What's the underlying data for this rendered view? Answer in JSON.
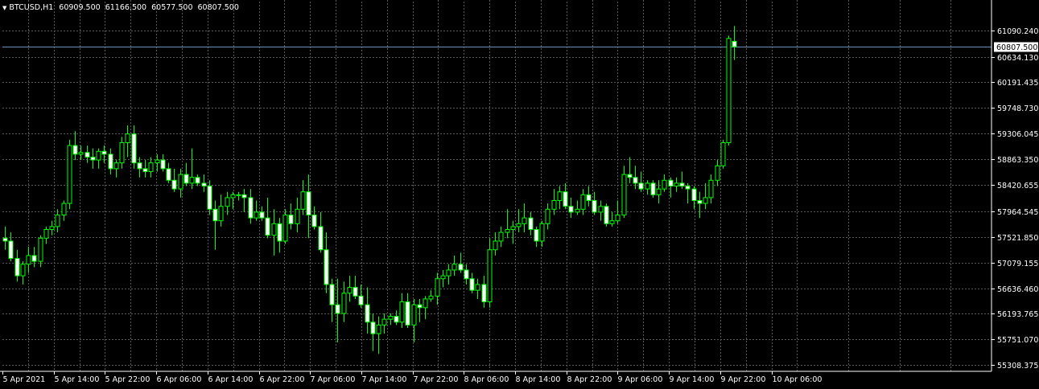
{
  "header": {
    "symbol": "BTCUSD,H1",
    "open": "60909.500",
    "high": "61166.500",
    "low": "60577.500",
    "close": "60807.500",
    "menu_icon": "triangle-down-icon"
  },
  "colors": {
    "background": "#000000",
    "grid": "#5a5a5a",
    "bull_body": "#000000",
    "bear_body": "#ffffff",
    "wick": "#00ff00",
    "axis_text": "#ffffff",
    "price_line": "#6f8faf"
  },
  "chart_data": {
    "type": "candlestick",
    "symbol": "BTCUSD",
    "timeframe": "H1",
    "price_axis_labels": [
      "61090.240",
      "60634.130",
      "60191.435",
      "59748.730",
      "59306.045",
      "58863.350",
      "58420.655",
      "57964.545",
      "57521.850",
      "57079.155",
      "56636.460",
      "56193.765",
      "55751.070",
      "55308.375"
    ],
    "time_axis_labels": [
      "5 Apr 2021",
      "5 Apr 14:00",
      "5 Apr 22:00",
      "6 Apr 06:00",
      "6 Apr 14:00",
      "6 Apr 22:00",
      "7 Apr 06:00",
      "7 Apr 14:00",
      "7 Apr 22:00",
      "8 Apr 06:00",
      "8 Apr 14:00",
      "8 Apr 22:00",
      "9 Apr 06:00",
      "9 Apr 14:00",
      "9 Apr 22:00",
      "10 Apr 06:00"
    ],
    "current_price": "60807.500",
    "grid": true,
    "ylim": [
      55200,
      61350
    ],
    "candles": [
      {
        "o": 57500,
        "h": 57700,
        "l": 57300,
        "c": 57450
      },
      {
        "o": 57450,
        "h": 57600,
        "l": 57100,
        "c": 57150
      },
      {
        "o": 57150,
        "h": 57300,
        "l": 56750,
        "c": 56850
      },
      {
        "o": 56850,
        "h": 57100,
        "l": 56700,
        "c": 57050
      },
      {
        "o": 57050,
        "h": 57350,
        "l": 56900,
        "c": 57200
      },
      {
        "o": 57200,
        "h": 57350,
        "l": 57000,
        "c": 57100
      },
      {
        "o": 57100,
        "h": 57550,
        "l": 57000,
        "c": 57500
      },
      {
        "o": 57500,
        "h": 57700,
        "l": 57400,
        "c": 57650
      },
      {
        "o": 57650,
        "h": 57800,
        "l": 57550,
        "c": 57700
      },
      {
        "o": 57700,
        "h": 58000,
        "l": 57600,
        "c": 57900
      },
      {
        "o": 57900,
        "h": 58150,
        "l": 57800,
        "c": 58100
      },
      {
        "o": 58100,
        "h": 59200,
        "l": 58000,
        "c": 59100
      },
      {
        "o": 59100,
        "h": 59350,
        "l": 58850,
        "c": 58950
      },
      {
        "o": 58950,
        "h": 59100,
        "l": 58850,
        "c": 58980
      },
      {
        "o": 58980,
        "h": 59100,
        "l": 58800,
        "c": 58900
      },
      {
        "o": 58900,
        "h": 59050,
        "l": 58700,
        "c": 58850
      },
      {
        "o": 58850,
        "h": 59050,
        "l": 58700,
        "c": 59000
      },
      {
        "o": 59000,
        "h": 59100,
        "l": 58800,
        "c": 58950
      },
      {
        "o": 58950,
        "h": 59050,
        "l": 58600,
        "c": 58700
      },
      {
        "o": 58700,
        "h": 58850,
        "l": 58550,
        "c": 58800
      },
      {
        "o": 58800,
        "h": 59250,
        "l": 58700,
        "c": 59150
      },
      {
        "o": 59150,
        "h": 59450,
        "l": 58900,
        "c": 59300
      },
      {
        "o": 59300,
        "h": 59450,
        "l": 58700,
        "c": 58800
      },
      {
        "o": 58800,
        "h": 58900,
        "l": 58550,
        "c": 58700
      },
      {
        "o": 58700,
        "h": 58850,
        "l": 58550,
        "c": 58650
      },
      {
        "o": 58650,
        "h": 58900,
        "l": 58550,
        "c": 58800
      },
      {
        "o": 58800,
        "h": 58950,
        "l": 58650,
        "c": 58850
      },
      {
        "o": 58850,
        "h": 58950,
        "l": 58650,
        "c": 58700
      },
      {
        "o": 58700,
        "h": 58800,
        "l": 58450,
        "c": 58500
      },
      {
        "o": 58500,
        "h": 58700,
        "l": 58300,
        "c": 58350
      },
      {
        "o": 58350,
        "h": 58700,
        "l": 58200,
        "c": 58600
      },
      {
        "o": 58600,
        "h": 58800,
        "l": 58400,
        "c": 58450
      },
      {
        "o": 58450,
        "h": 59050,
        "l": 58350,
        "c": 58550
      },
      {
        "o": 58550,
        "h": 58600,
        "l": 58400,
        "c": 58450
      },
      {
        "o": 58450,
        "h": 58600,
        "l": 58300,
        "c": 58400
      },
      {
        "o": 58400,
        "h": 58500,
        "l": 57900,
        "c": 58000
      },
      {
        "o": 58000,
        "h": 58150,
        "l": 57300,
        "c": 57800
      },
      {
        "o": 57800,
        "h": 58250,
        "l": 57700,
        "c": 58050
      },
      {
        "o": 58050,
        "h": 58300,
        "l": 57900,
        "c": 58200
      },
      {
        "o": 58200,
        "h": 58300,
        "l": 58000,
        "c": 58250
      },
      {
        "o": 58250,
        "h": 58300,
        "l": 58150,
        "c": 58250
      },
      {
        "o": 58250,
        "h": 58350,
        "l": 57950,
        "c": 58200
      },
      {
        "o": 58200,
        "h": 58350,
        "l": 57750,
        "c": 57850
      },
      {
        "o": 57850,
        "h": 58150,
        "l": 57800,
        "c": 57950
      },
      {
        "o": 57950,
        "h": 58050,
        "l": 57800,
        "c": 57850
      },
      {
        "o": 57850,
        "h": 58200,
        "l": 57500,
        "c": 57550
      },
      {
        "o": 57550,
        "h": 58000,
        "l": 57200,
        "c": 57750
      },
      {
        "o": 57750,
        "h": 57850,
        "l": 57250,
        "c": 57450
      },
      {
        "o": 57450,
        "h": 58000,
        "l": 57400,
        "c": 57900
      },
      {
        "o": 57900,
        "h": 58100,
        "l": 57650,
        "c": 57750
      },
      {
        "o": 57750,
        "h": 58200,
        "l": 57600,
        "c": 58000
      },
      {
        "o": 58000,
        "h": 58500,
        "l": 57900,
        "c": 58300
      },
      {
        "o": 58300,
        "h": 58600,
        "l": 57500,
        "c": 57900
      },
      {
        "o": 57900,
        "h": 58050,
        "l": 57650,
        "c": 57700
      },
      {
        "o": 57700,
        "h": 57950,
        "l": 57250,
        "c": 57300
      },
      {
        "o": 57300,
        "h": 57600,
        "l": 56550,
        "c": 56700
      },
      {
        "o": 56700,
        "h": 56800,
        "l": 56050,
        "c": 56350
      },
      {
        "o": 56350,
        "h": 56800,
        "l": 55700,
        "c": 56200
      },
      {
        "o": 56200,
        "h": 56750,
        "l": 56050,
        "c": 56550
      },
      {
        "o": 56550,
        "h": 56850,
        "l": 56400,
        "c": 56650
      },
      {
        "o": 56650,
        "h": 56850,
        "l": 56450,
        "c": 56500
      },
      {
        "o": 56500,
        "h": 56700,
        "l": 56300,
        "c": 56350
      },
      {
        "o": 56350,
        "h": 56650,
        "l": 55850,
        "c": 56050
      },
      {
        "o": 56050,
        "h": 56200,
        "l": 55550,
        "c": 55850
      },
      {
        "o": 55850,
        "h": 56150,
        "l": 55500,
        "c": 56000
      },
      {
        "o": 56000,
        "h": 56200,
        "l": 55850,
        "c": 56100
      },
      {
        "o": 56100,
        "h": 56200,
        "l": 56000,
        "c": 56150
      },
      {
        "o": 56150,
        "h": 56250,
        "l": 56000,
        "c": 56050
      },
      {
        "o": 56050,
        "h": 56550,
        "l": 55950,
        "c": 56400
      },
      {
        "o": 56400,
        "h": 56550,
        "l": 55950,
        "c": 56000
      },
      {
        "o": 56000,
        "h": 56450,
        "l": 55700,
        "c": 56350
      },
      {
        "o": 56350,
        "h": 56450,
        "l": 56050,
        "c": 56300
      },
      {
        "o": 56300,
        "h": 56500,
        "l": 56100,
        "c": 56450
      },
      {
        "o": 56450,
        "h": 56600,
        "l": 56400,
        "c": 56500
      },
      {
        "o": 56500,
        "h": 56900,
        "l": 56350,
        "c": 56800
      },
      {
        "o": 56800,
        "h": 56950,
        "l": 56650,
        "c": 56850
      },
      {
        "o": 56850,
        "h": 57050,
        "l": 56700,
        "c": 56950
      },
      {
        "o": 56950,
        "h": 57200,
        "l": 56850,
        "c": 57050
      },
      {
        "o": 57050,
        "h": 57250,
        "l": 56900,
        "c": 56950
      },
      {
        "o": 56950,
        "h": 57050,
        "l": 56700,
        "c": 56800
      },
      {
        "o": 56800,
        "h": 56900,
        "l": 56550,
        "c": 56600
      },
      {
        "o": 56600,
        "h": 56800,
        "l": 56450,
        "c": 56700
      },
      {
        "o": 56700,
        "h": 56850,
        "l": 56300,
        "c": 56400
      },
      {
        "o": 56400,
        "h": 57500,
        "l": 56300,
        "c": 57300
      },
      {
        "o": 57300,
        "h": 57600,
        "l": 57200,
        "c": 57450
      },
      {
        "o": 57450,
        "h": 57700,
        "l": 57350,
        "c": 57600
      },
      {
        "o": 57600,
        "h": 58000,
        "l": 57500,
        "c": 57650
      },
      {
        "o": 57650,
        "h": 57800,
        "l": 57400,
        "c": 57700
      },
      {
        "o": 57700,
        "h": 58000,
        "l": 57600,
        "c": 57750
      },
      {
        "o": 57750,
        "h": 58100,
        "l": 57600,
        "c": 57850
      },
      {
        "o": 57850,
        "h": 57950,
        "l": 57550,
        "c": 57650
      },
      {
        "o": 57650,
        "h": 57700,
        "l": 57350,
        "c": 57450
      },
      {
        "o": 57450,
        "h": 57800,
        "l": 57350,
        "c": 57750
      },
      {
        "o": 57750,
        "h": 58100,
        "l": 57650,
        "c": 58000
      },
      {
        "o": 58000,
        "h": 58350,
        "l": 57900,
        "c": 58150
      },
      {
        "o": 58150,
        "h": 58400,
        "l": 58000,
        "c": 58300
      },
      {
        "o": 58300,
        "h": 58450,
        "l": 58000,
        "c": 58050
      },
      {
        "o": 58050,
        "h": 58200,
        "l": 57850,
        "c": 57950
      },
      {
        "o": 57950,
        "h": 58150,
        "l": 57900,
        "c": 58000
      },
      {
        "o": 58000,
        "h": 58350,
        "l": 57900,
        "c": 58250
      },
      {
        "o": 58250,
        "h": 58400,
        "l": 58050,
        "c": 58150
      },
      {
        "o": 58150,
        "h": 58300,
        "l": 57900,
        "c": 57950
      },
      {
        "o": 57950,
        "h": 58150,
        "l": 57800,
        "c": 58050
      },
      {
        "o": 58050,
        "h": 58100,
        "l": 57700,
        "c": 57750
      },
      {
        "o": 57750,
        "h": 57950,
        "l": 57700,
        "c": 57800
      },
      {
        "o": 57800,
        "h": 58150,
        "l": 57750,
        "c": 57900
      },
      {
        "o": 57900,
        "h": 58750,
        "l": 57850,
        "c": 58600
      },
      {
        "o": 58600,
        "h": 58900,
        "l": 58450,
        "c": 58550
      },
      {
        "o": 58550,
        "h": 58750,
        "l": 58350,
        "c": 58450
      },
      {
        "o": 58450,
        "h": 58650,
        "l": 58300,
        "c": 58350
      },
      {
        "o": 58350,
        "h": 58500,
        "l": 58250,
        "c": 58450
      },
      {
        "o": 58450,
        "h": 58500,
        "l": 58200,
        "c": 58250
      },
      {
        "o": 58250,
        "h": 58500,
        "l": 58100,
        "c": 58350
      },
      {
        "o": 58350,
        "h": 58600,
        "l": 58300,
        "c": 58500
      },
      {
        "o": 58500,
        "h": 58550,
        "l": 58200,
        "c": 58400
      },
      {
        "o": 58400,
        "h": 58550,
        "l": 58300,
        "c": 58450
      },
      {
        "o": 58450,
        "h": 58650,
        "l": 58350,
        "c": 58400
      },
      {
        "o": 58400,
        "h": 58450,
        "l": 58100,
        "c": 58350
      },
      {
        "o": 58350,
        "h": 58400,
        "l": 58000,
        "c": 58150
      },
      {
        "o": 58150,
        "h": 58300,
        "l": 57850,
        "c": 58100
      },
      {
        "o": 58100,
        "h": 58450,
        "l": 58000,
        "c": 58200
      },
      {
        "o": 58200,
        "h": 58600,
        "l": 58100,
        "c": 58500
      },
      {
        "o": 58500,
        "h": 58850,
        "l": 58400,
        "c": 58750
      },
      {
        "o": 58750,
        "h": 59200,
        "l": 58700,
        "c": 59150
      },
      {
        "o": 59150,
        "h": 61000,
        "l": 59100,
        "c": 60950
      },
      {
        "o": 60900,
        "h": 61166,
        "l": 60577,
        "c": 60807
      }
    ]
  }
}
